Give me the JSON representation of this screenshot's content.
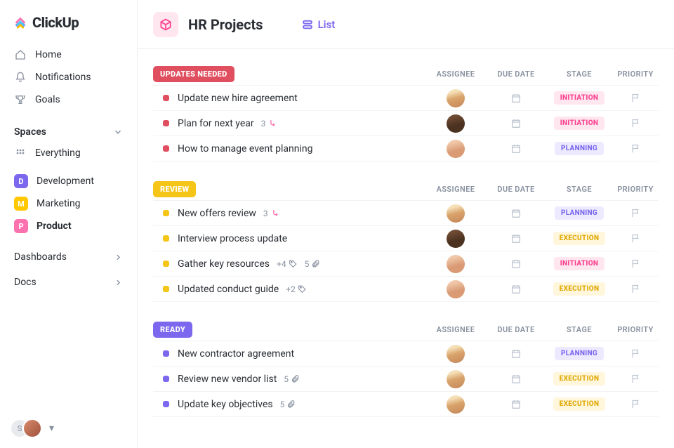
{
  "brand": "ClickUp",
  "sidebar": {
    "nav": [
      {
        "label": "Home"
      },
      {
        "label": "Notifications"
      },
      {
        "label": "Goals"
      }
    ],
    "spaces_header": "Spaces",
    "everything_label": "Everything",
    "spaces": [
      {
        "letter": "D",
        "label": "Development",
        "color": "#7b68ee",
        "active": false
      },
      {
        "letter": "M",
        "label": "Marketing",
        "color": "#ffc800",
        "active": false
      },
      {
        "letter": "P",
        "label": "Product",
        "color": "#fd71af",
        "active": true
      }
    ],
    "dashboards_label": "Dashboards",
    "docs_label": "Docs",
    "user_initial": "S"
  },
  "project": {
    "title": "HR Projects",
    "view_label": "List"
  },
  "columns": {
    "assignee": "ASSIGNEE",
    "due": "DUE DATE",
    "stage": "STAGE",
    "priority": "PRIORITY"
  },
  "groups": [
    {
      "name": "UPDATES NEEDED",
      "color": "#e04f5f",
      "dot": "#e04f5f",
      "tasks": [
        {
          "title": "Update new hire agreement",
          "avatar": "f1",
          "stage": "INITIATION",
          "stageClass": "stage-initiation"
        },
        {
          "title": "Plan for next year",
          "avatar": "m1",
          "stage": "INITIATION",
          "stageClass": "stage-initiation",
          "subtasks": "3"
        },
        {
          "title": "How to manage event planning",
          "avatar": "m2",
          "stage": "PLANNING",
          "stageClass": "stage-planning"
        }
      ]
    },
    {
      "name": "REVIEW",
      "color": "#f5c518",
      "dot": "#f5c518",
      "tasks": [
        {
          "title": "New offers review",
          "avatar": "f1",
          "stage": "PLANNING",
          "stageClass": "stage-planning",
          "subtasks": "3"
        },
        {
          "title": "Interview process update",
          "avatar": "m1",
          "stage": "EXECUTION",
          "stageClass": "stage-execution"
        },
        {
          "title": "Gather key resources",
          "avatar": "m2",
          "stage": "INITIATION",
          "stageClass": "stage-initiation",
          "tags": "+4",
          "attach": "5"
        },
        {
          "title": "Updated conduct guide",
          "avatar": "m2",
          "stage": "EXECUTION",
          "stageClass": "stage-execution",
          "tags": "+2"
        }
      ]
    },
    {
      "name": "READY",
      "color": "#7b68ee",
      "dot": "#7b68ee",
      "tasks": [
        {
          "title": "New contractor agreement",
          "avatar": "f1",
          "stage": "PLANNING",
          "stageClass": "stage-planning"
        },
        {
          "title": "Review new vendor list",
          "avatar": "f1",
          "stage": "EXECUTION",
          "stageClass": "stage-execution",
          "attach": "5"
        },
        {
          "title": "Update key objectives",
          "avatar": "f1",
          "stage": "EXECUTION",
          "stageClass": "stage-execution",
          "attach": "5"
        }
      ]
    }
  ]
}
